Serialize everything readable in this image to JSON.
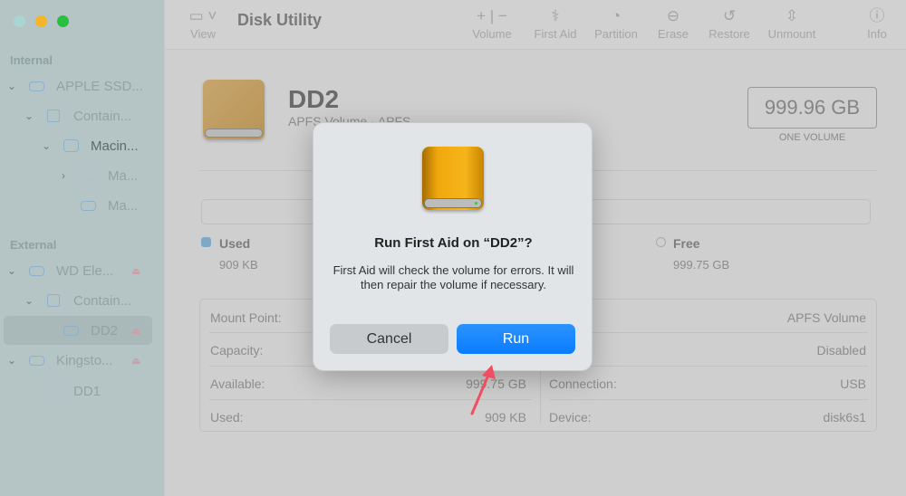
{
  "window": {
    "title": "Disk Utility"
  },
  "toolbar": {
    "view": "View",
    "volume": "Volume",
    "first_aid": "First Aid",
    "partition": "Partition",
    "erase": "Erase",
    "restore": "Restore",
    "unmount": "Unmount",
    "info": "Info"
  },
  "sidebar": {
    "internal_label": "Internal",
    "external_label": "External",
    "items": [
      {
        "label": "APPLE SSD..."
      },
      {
        "label": "Contain..."
      },
      {
        "label": "Macin..."
      },
      {
        "label": "Ma..."
      },
      {
        "label": "Ma..."
      },
      {
        "label": "WD Ele..."
      },
      {
        "label": "Contain..."
      },
      {
        "label": "DD2"
      },
      {
        "label": "Kingsto..."
      },
      {
        "label": "DD1"
      }
    ]
  },
  "volume": {
    "name": "DD2",
    "subtitle": "APFS Volume · APFS",
    "size": "999.96 GB",
    "size_caption": "ONE VOLUME",
    "used_label": "Used",
    "used_value": "909 KB",
    "free_label": "Free",
    "free_value": "999.75 GB"
  },
  "info": {
    "left": [
      {
        "k": "Mount Point:",
        "v": ""
      },
      {
        "k": "Capacity:",
        "v": ""
      },
      {
        "k": "Available:",
        "v": "999.75 GB"
      },
      {
        "k": "Used:",
        "v": "909 KB"
      }
    ],
    "right": [
      {
        "k": "",
        "v": "APFS Volume"
      },
      {
        "k": "",
        "v": "Disabled"
      },
      {
        "k": "Connection:",
        "v": "USB"
      },
      {
        "k": "Device:",
        "v": "disk6s1"
      }
    ]
  },
  "dialog": {
    "title": "Run First Aid on “DD2”?",
    "message": "First Aid will check the volume for errors. It will then repair the volume if necessary.",
    "cancel": "Cancel",
    "run": "Run"
  },
  "colors": {
    "accent": "#0a7cff",
    "annotation_arrow": "#ef4f63"
  }
}
